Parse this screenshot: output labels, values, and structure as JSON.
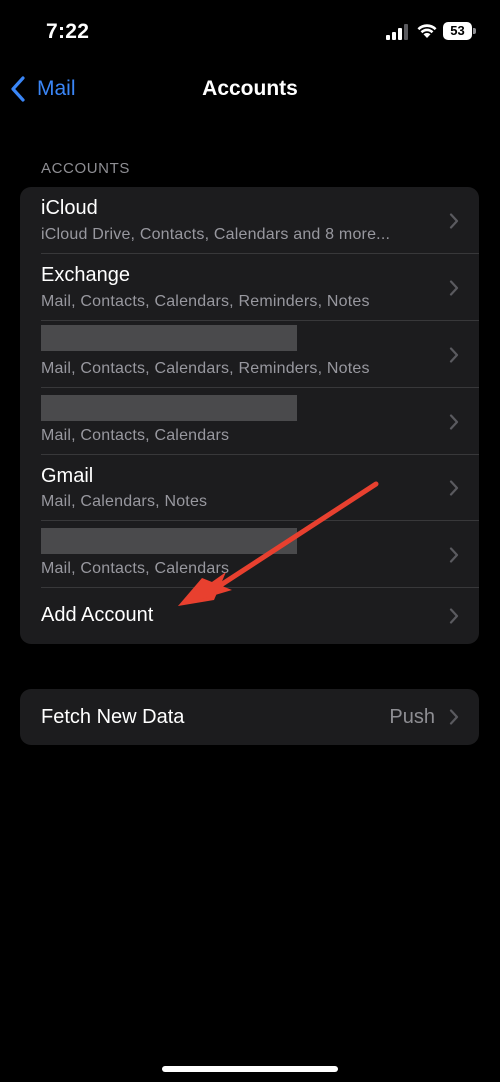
{
  "status_bar": {
    "time": "7:22",
    "battery_level": "53",
    "icons": [
      "cellular-signal-icon",
      "wifi-icon",
      "battery-icon"
    ]
  },
  "nav": {
    "back_label": "Mail",
    "title": "Accounts"
  },
  "accounts_section": {
    "header": "ACCOUNTS",
    "rows": [
      {
        "title": "iCloud",
        "subtitle": "iCloud Drive, Contacts, Calendars and 8 more..."
      },
      {
        "title": "Exchange",
        "subtitle": "Mail, Contacts, Calendars, Reminders, Notes"
      },
      {
        "title": "",
        "subtitle": "Mail, Contacts, Calendars, Reminders, Notes",
        "redacted": true
      },
      {
        "title": "",
        "subtitle": "Mail, Contacts, Calendars",
        "redacted": true
      },
      {
        "title": "Gmail",
        "subtitle": "Mail, Calendars, Notes"
      },
      {
        "title": "",
        "subtitle": "Mail, Contacts, Calendars",
        "redacted": true
      }
    ],
    "add_account_label": "Add Account"
  },
  "fetch_section": {
    "label": "Fetch New Data",
    "value": "Push"
  },
  "colors": {
    "background": "#000000",
    "group_background": "#1c1c1e",
    "accent": "#3a86f7",
    "annotation_arrow": "#e8402f"
  }
}
